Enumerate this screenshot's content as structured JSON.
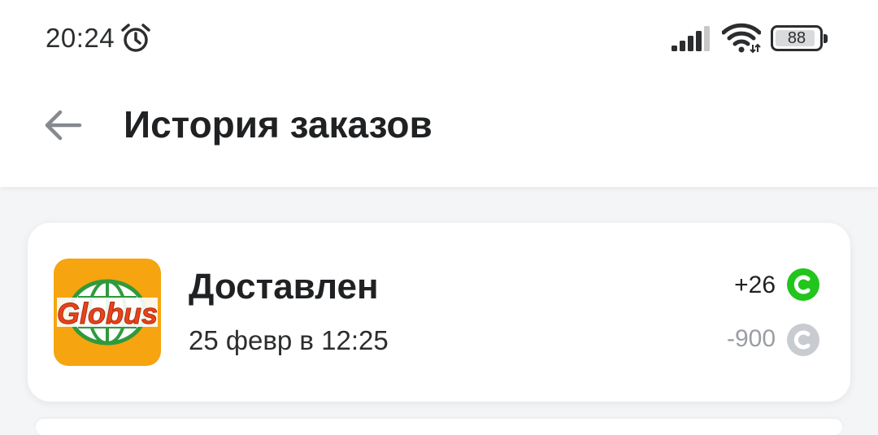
{
  "status_bar": {
    "time": "20:24",
    "battery": "88",
    "icons": [
      "alarm-icon",
      "signal-icon",
      "wifi-icon",
      "battery-icon"
    ]
  },
  "header": {
    "back_icon": "arrow-left-icon",
    "title": "История заказов"
  },
  "orders": [
    {
      "store_logo_text": "Globus",
      "status": "Доставлен",
      "date": "25 февр в 12:25",
      "bonus_earned": "+26",
      "bonus_spent": "-900",
      "earned_coin_color": "#21c51b",
      "spent_coin_color": "#c8cbcf"
    }
  ],
  "colors": {
    "logo_bg": "#f6a410",
    "logo_text": "#e8421c",
    "logo_globe": "#2f9a3c"
  }
}
